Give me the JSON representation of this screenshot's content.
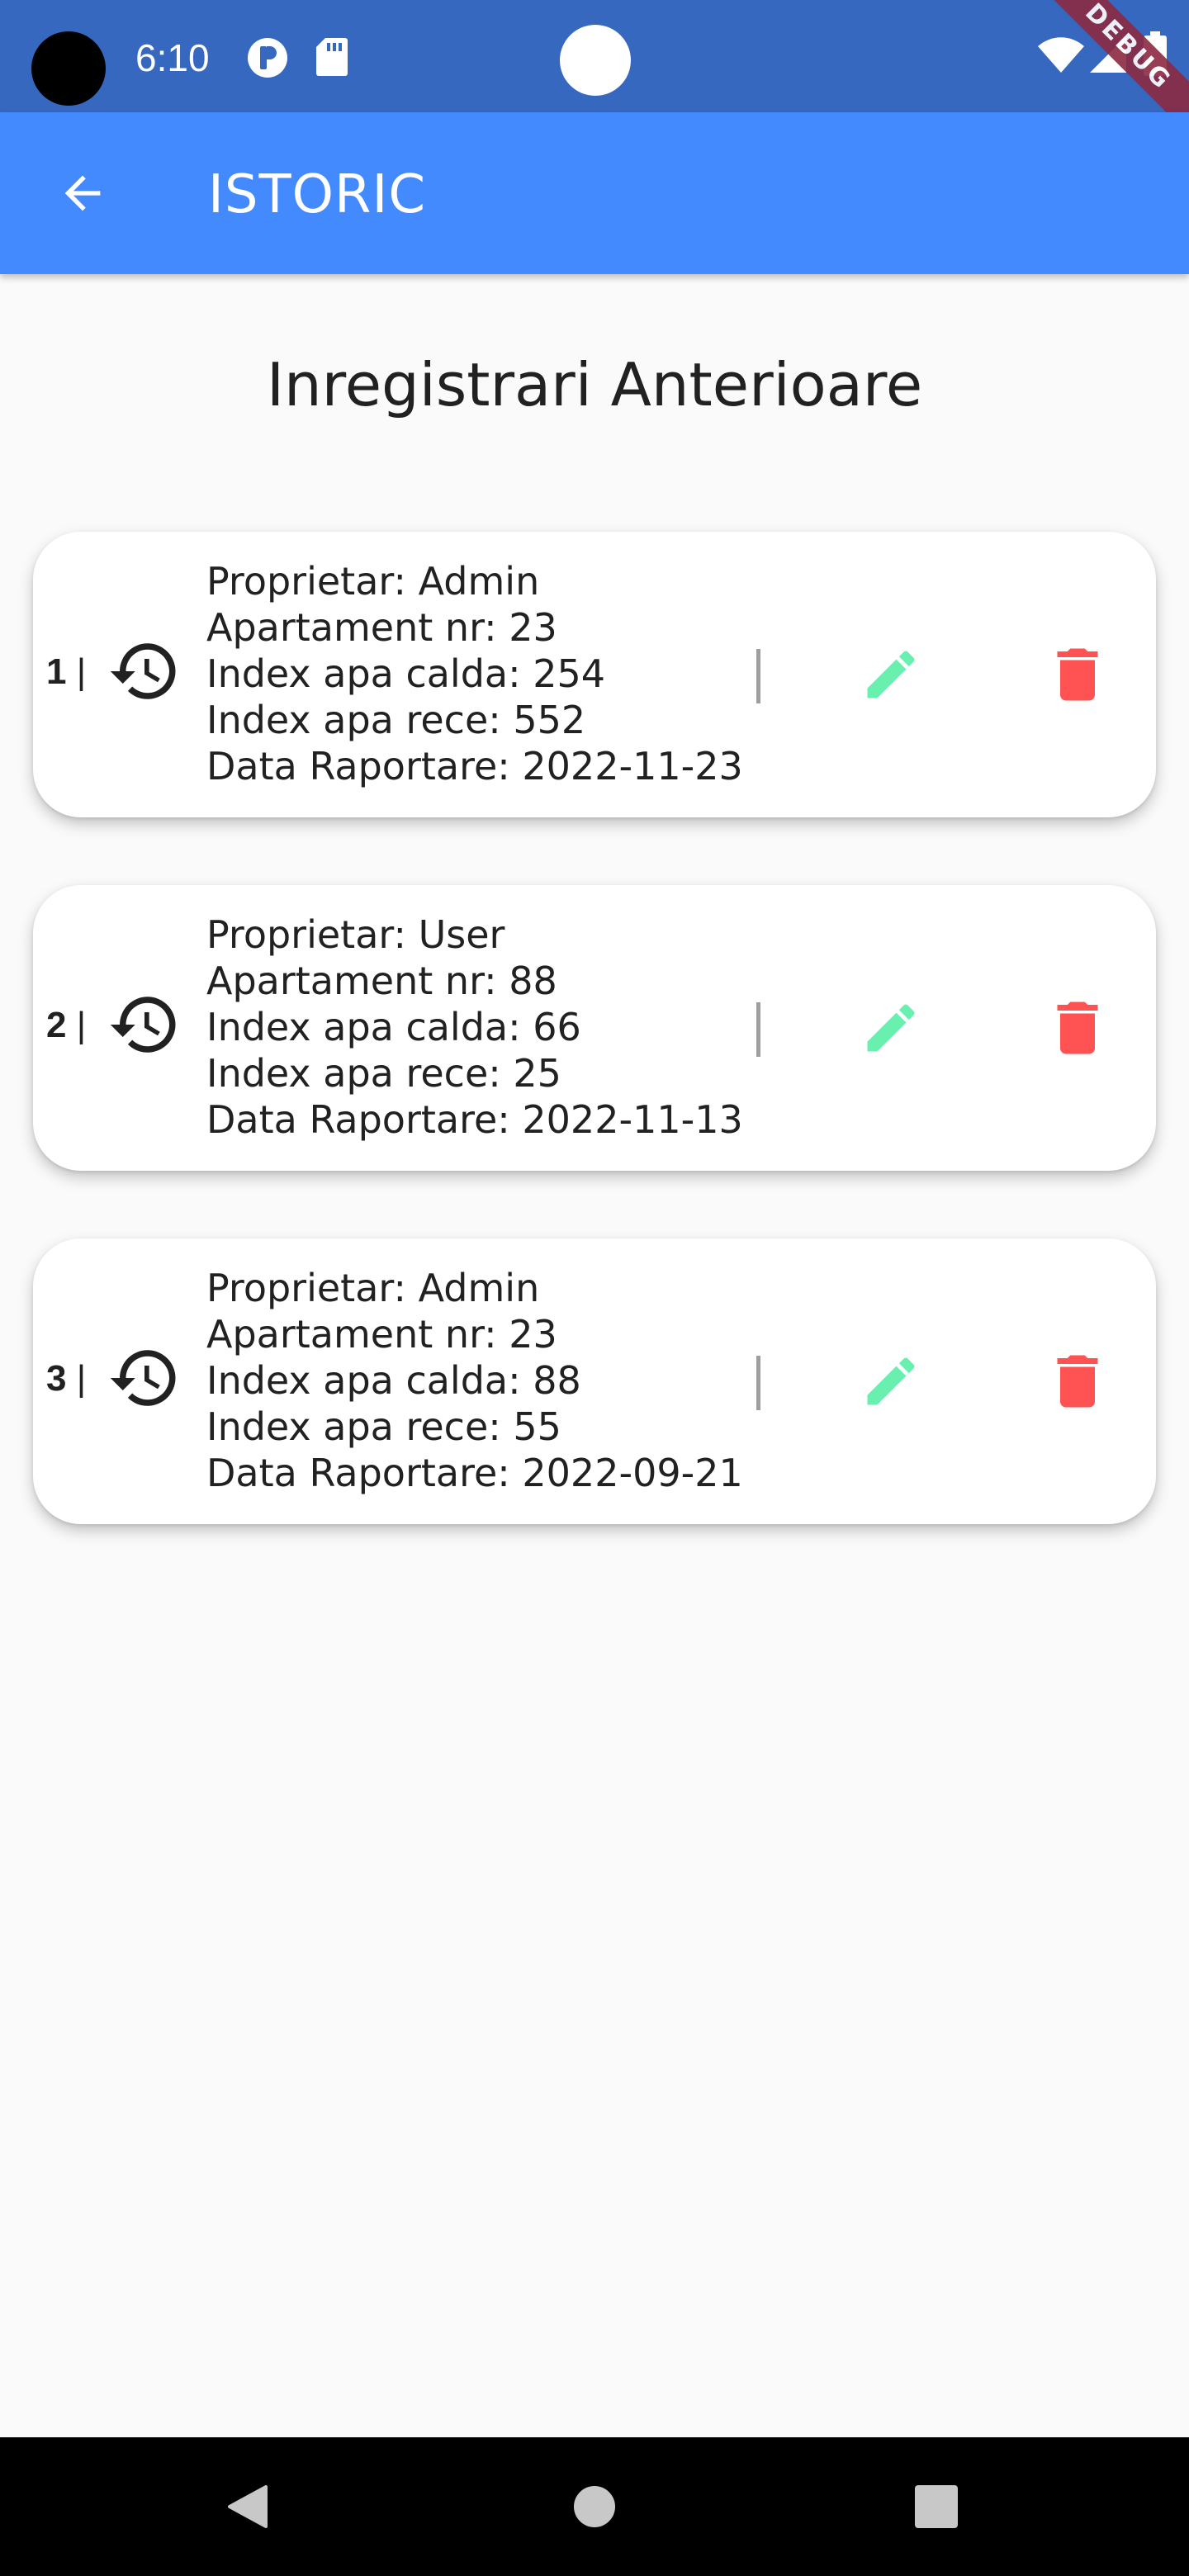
{
  "status_bar": {
    "time": "6:10",
    "debug_label": "DEBUG"
  },
  "app_bar": {
    "title": "ISTORIC",
    "back_icon": "arrow-back-icon"
  },
  "page": {
    "heading": "Inregistrari Anterioare"
  },
  "colors": {
    "status_bar": "#3768c0",
    "app_bar": "#448aff",
    "edit_icon": "#69f0ae",
    "delete_icon": "#ff5252",
    "background": "#fafafa"
  },
  "records": [
    {
      "index": "1",
      "separator": "|",
      "owner": "Proprietar: Admin",
      "apartment": "Apartament nr: 23",
      "hot_water": "Index apa calda: 254",
      "cold_water": "Index apa rece: 552",
      "report_date": "Data Raportare: 2022-11-23"
    },
    {
      "index": "2",
      "separator": "|",
      "owner": "Proprietar: User",
      "apartment": "Apartament nr: 88",
      "hot_water": "Index apa calda: 66",
      "cold_water": "Index apa rece: 25",
      "report_date": "Data Raportare: 2022-11-13"
    },
    {
      "index": "3",
      "separator": "|",
      "owner": "Proprietar: Admin",
      "apartment": "Apartament nr: 23",
      "hot_water": "Index apa calda: 88",
      "cold_water": "Index apa rece: 55",
      "report_date": "Data Raportare: 2022-09-21"
    }
  ]
}
